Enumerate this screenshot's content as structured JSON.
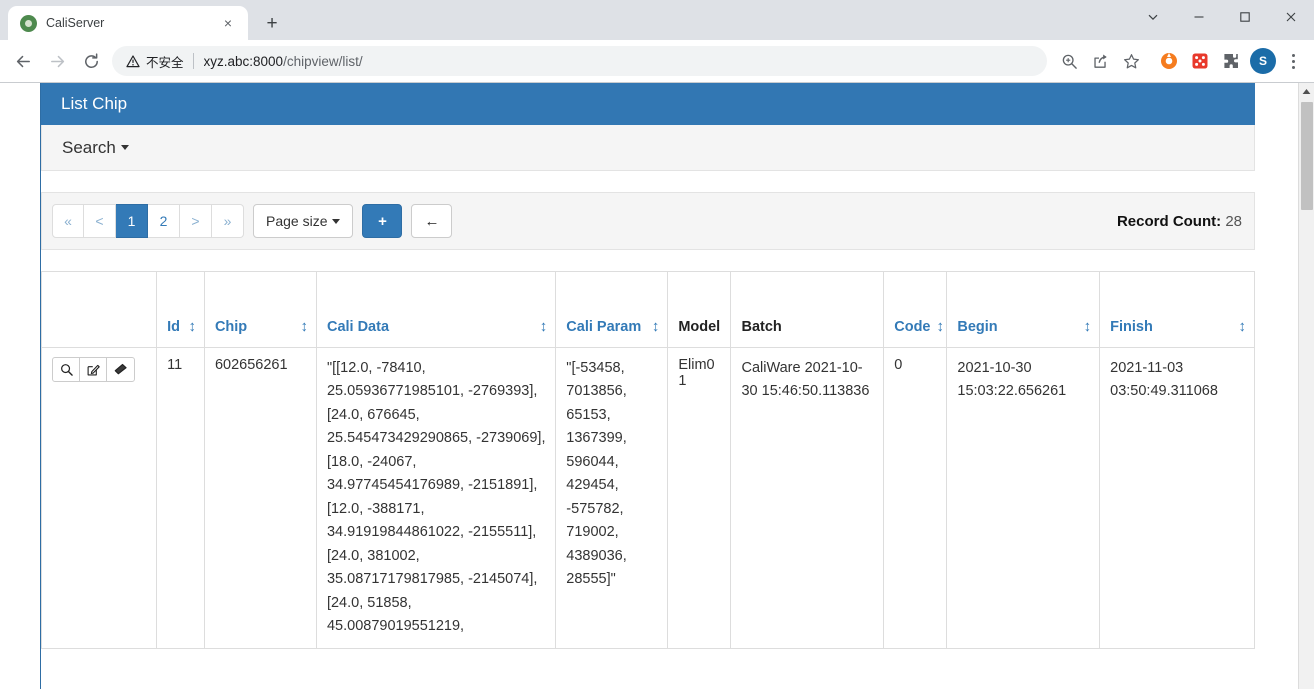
{
  "browser": {
    "tab": {
      "title": "CaliServer",
      "favicon": "globe-icon",
      "close": "×"
    },
    "new_tab": "+",
    "window_controls": {
      "more": "∨",
      "minimize": "—",
      "maximize": "□",
      "close": "✕"
    },
    "nav": {
      "back": "←",
      "forward": "→",
      "reload": "⟳"
    },
    "omnibox": {
      "security_label": "不安全",
      "security_icon": "warning-triangle-icon",
      "url_host": "xyz.abc:8000",
      "url_path": "/chipview/list/"
    },
    "toolbar_icons": [
      "zoom-in-icon",
      "share-icon",
      "star-icon",
      "orange-circle-extension-icon",
      "red-dice-extension-icon",
      "puzzle-extension-icon"
    ],
    "profile_initial": "S"
  },
  "app": {
    "panel_title": "List Chip",
    "search_label": "Search"
  },
  "pagination": {
    "first": "«",
    "prev": "<",
    "pages": [
      "1",
      "2"
    ],
    "active_page": "1",
    "next": ">",
    "last": "»",
    "page_size_label": "Page size",
    "add_label": "+",
    "back_label": "←"
  },
  "record_count": {
    "label": "Record Count:",
    "value": "28"
  },
  "table": {
    "sort_icon": "↕",
    "columns": [
      {
        "label": "",
        "sortable": false,
        "plain": true
      },
      {
        "label": "Id",
        "sortable": true,
        "plain": false
      },
      {
        "label": "Chip",
        "sortable": true,
        "plain": false
      },
      {
        "label": "Cali Data",
        "sortable": true,
        "plain": false
      },
      {
        "label": "Cali Param",
        "sortable": true,
        "plain": false
      },
      {
        "label": "Model",
        "sortable": false,
        "plain": true
      },
      {
        "label": "Batch",
        "sortable": false,
        "plain": true
      },
      {
        "label": "Code",
        "sortable": true,
        "plain": false
      },
      {
        "label": "Begin",
        "sortable": true,
        "plain": false
      },
      {
        "label": "Finish",
        "sortable": true,
        "plain": false
      }
    ],
    "row_actions": [
      {
        "name": "view-icon",
        "glyph": "⚲"
      },
      {
        "name": "edit-icon",
        "glyph": "✎"
      },
      {
        "name": "erase-icon",
        "glyph": "▰"
      }
    ],
    "rows": [
      {
        "id": "11",
        "chip": "602656261",
        "cali_data": "\"[[12.0, -78410, 25.05936771985101, -2769393], [24.0, 676645, 25.545473429290865, -2739069], [18.0, -24067, 34.97745454176989, -2151891], [12.0, -388171, 34.91919844861022, -2155511], [24.0, 381002, 35.08717179817985, -2145074], [24.0, 51858, 45.00879019551219,",
        "cali_param": "\"[-53458, 7013856, 65153, 1367399, 596044, 429454, -575782, 719002, 4389036, 28555]\"",
        "model": "Elim01",
        "batch": "CaliWare 2021-10-30 15:46:50.113836",
        "code": "0",
        "begin": "2021-10-30 15:03:22.656261",
        "finish": "2021-11-03 03:50:49.311068"
      }
    ]
  },
  "colors": {
    "panel_header_bg": "#3277b3",
    "link_blue": "#337ab7",
    "active_page_bg": "#337ab7",
    "profile_bg": "#1b6ca8"
  }
}
